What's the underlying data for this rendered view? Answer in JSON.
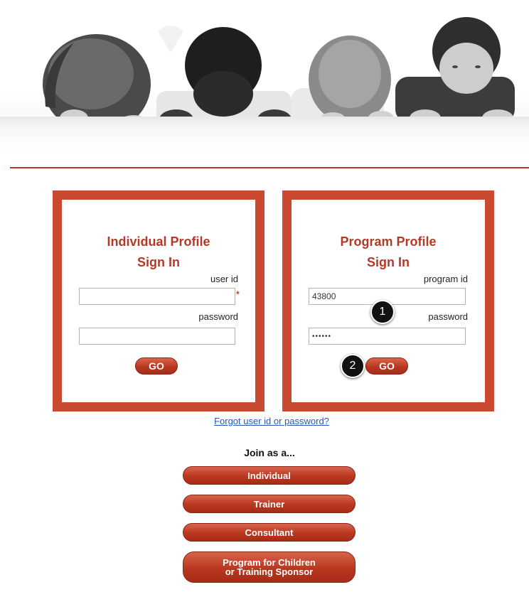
{
  "colors": {
    "brand_red": "#c94a31",
    "title_red": "#b23a28",
    "link_blue": "#2b57b5"
  },
  "hero": {
    "image_description": "four children peeking over a white ledge"
  },
  "individual_signin": {
    "title_line1": "Individual Profile",
    "title_line2": "Sign In",
    "userid_label": "user id",
    "userid_value": "",
    "required_marker": "*",
    "password_label": "password",
    "password_value": "",
    "go_label": "GO"
  },
  "program_signin": {
    "title_line1": "Program Profile",
    "title_line2": "Sign In",
    "programid_label": "program id",
    "programid_value": "43800",
    "password_label": "password",
    "password_value": "••••••",
    "go_label": "GO"
  },
  "step_markers": [
    "1",
    "2"
  ],
  "forgot_link": "Forgot user id or password?",
  "join": {
    "heading": "Join as a...",
    "options": [
      "Individual",
      "Trainer",
      "Consultant",
      "Program for Children",
      "or Training Sponsor"
    ]
  }
}
